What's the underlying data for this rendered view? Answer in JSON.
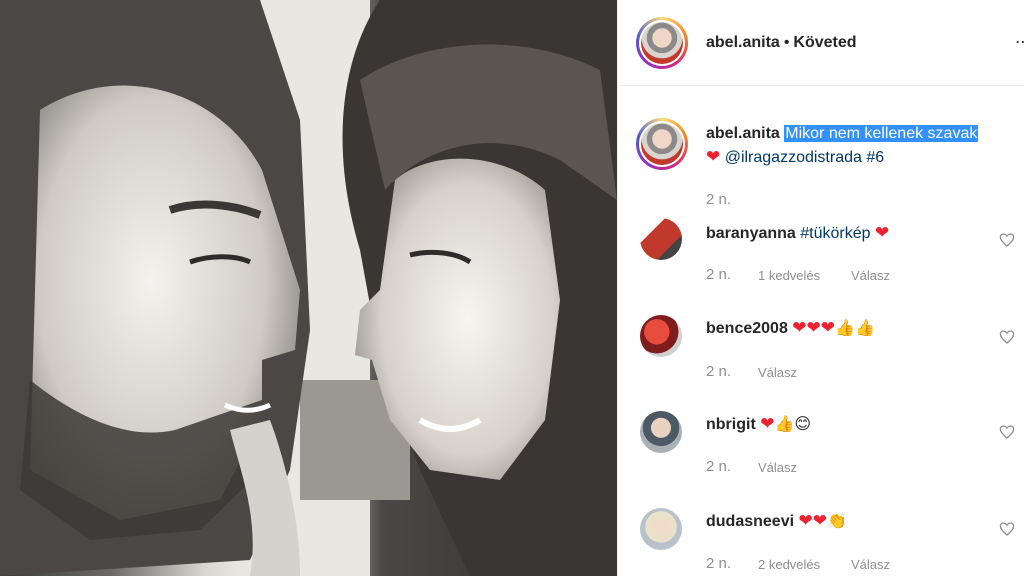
{
  "post": {
    "username": "abel.anita",
    "follow_status": "Követed",
    "caption_selected": "Mikor nem kellenek szavak",
    "caption_mention": "@ilragazzodistrada",
    "caption_hashtag": "#6",
    "caption_age": "2 n."
  },
  "comments": [
    {
      "username": "baranyanna",
      "tag": "#tükörkép",
      "emojis": "❤",
      "age": "2 n.",
      "likes": "1 kedvelés",
      "reply": "Válasz"
    },
    {
      "username": "bence2008",
      "emojis_hearts": "❤❤❤",
      "emojis_other": "👍👍",
      "age": "2 n.",
      "reply": "Válasz"
    },
    {
      "username": "nbrigit",
      "emojis_hearts": "❤",
      "emojis_other": "👍😊",
      "age": "2 n.",
      "reply": "Válasz"
    },
    {
      "username": "dudasneevi",
      "emojis_hearts": "❤❤",
      "emojis_other": "👏",
      "age": "2 n.",
      "likes": "2 kedvelés",
      "reply": "Válasz"
    }
  ]
}
